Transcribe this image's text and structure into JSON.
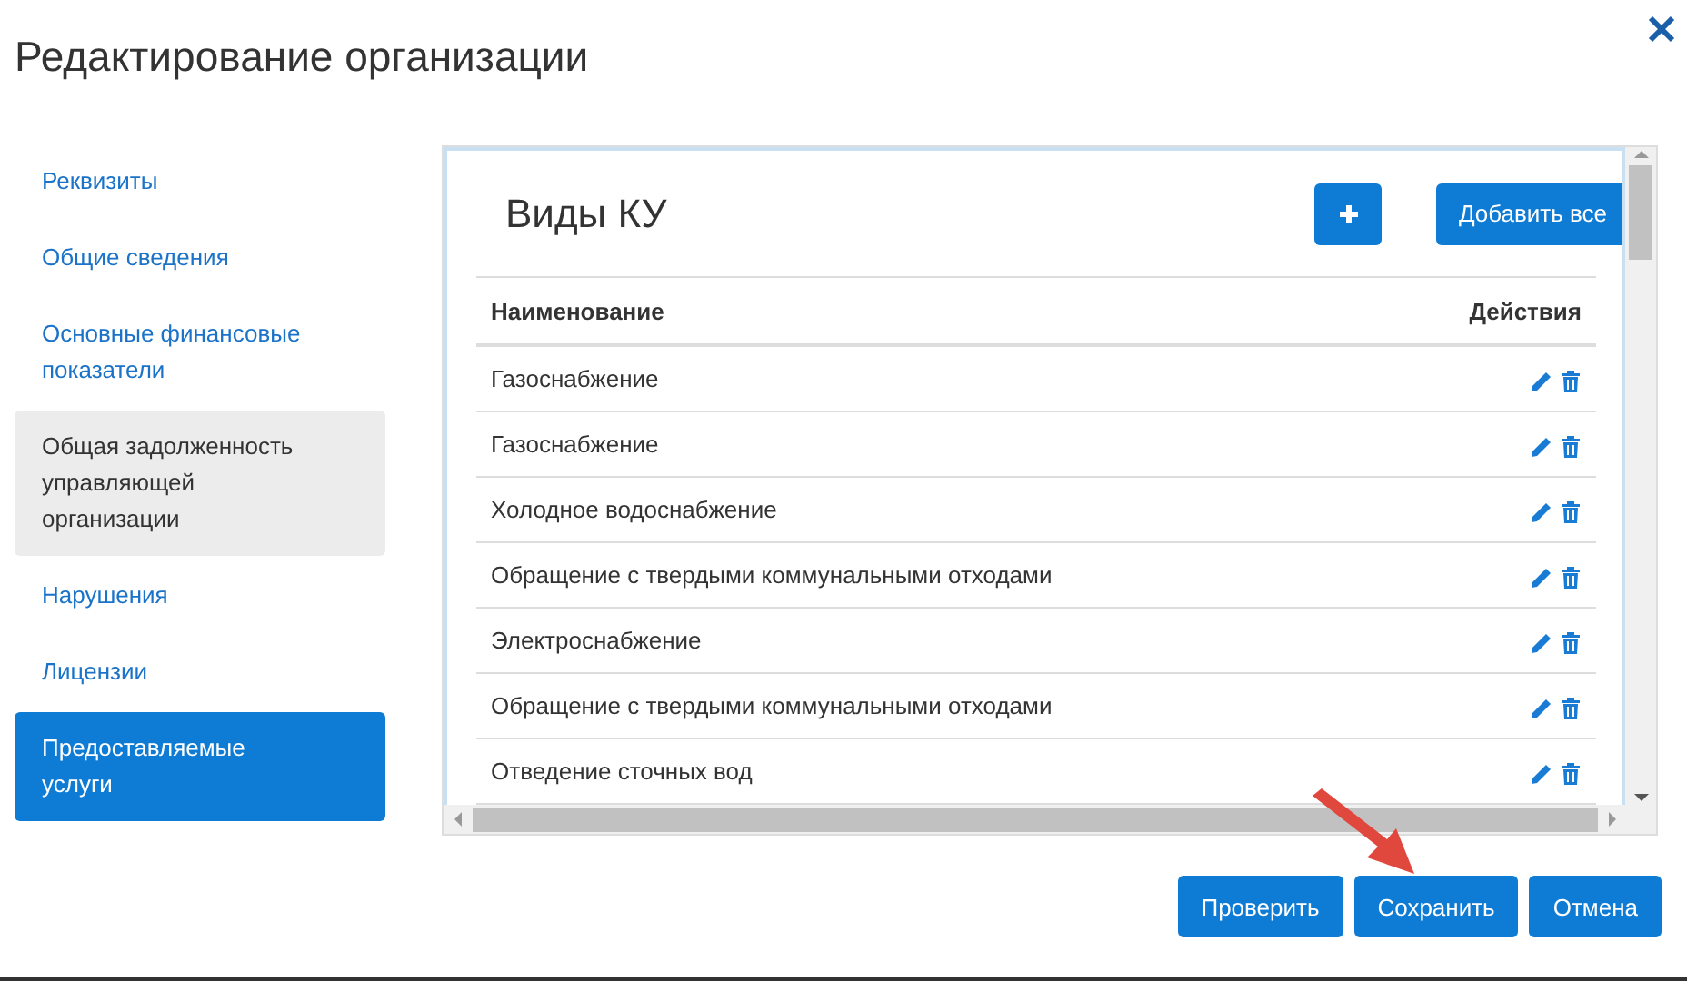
{
  "dialog": {
    "title": "Редактирование организации"
  },
  "sidebar": {
    "items": [
      {
        "label": "Реквизиты",
        "selected": false,
        "hovered": false
      },
      {
        "label": "Общие сведения",
        "selected": false,
        "hovered": false
      },
      {
        "label": "Основные финансовые показатели",
        "selected": false,
        "hovered": false
      },
      {
        "label": "Общая задолженность управляющей организации",
        "selected": false,
        "hovered": true
      },
      {
        "label": "Нарушения",
        "selected": false,
        "hovered": false
      },
      {
        "label": "Лицензии",
        "selected": false,
        "hovered": false
      },
      {
        "label": "Предоставляемые услуги",
        "selected": true,
        "hovered": false
      }
    ]
  },
  "panel": {
    "title": "Виды КУ",
    "add_all_button": "Добавить все",
    "table": {
      "columns": [
        "Наименование",
        "Действия"
      ],
      "rows": [
        {
          "name": "Газоснабжение"
        },
        {
          "name": "Газоснабжение"
        },
        {
          "name": "Холодное водоснабжение"
        },
        {
          "name": "Обращение с твердыми коммунальными отходами"
        },
        {
          "name": "Электроснабжение"
        },
        {
          "name": "Обращение с твердыми коммунальными отходами"
        },
        {
          "name": "Отведение сточных вод"
        }
      ]
    }
  },
  "buttons": [
    "Проверить",
    "Сохранить",
    "Отмена"
  ]
}
